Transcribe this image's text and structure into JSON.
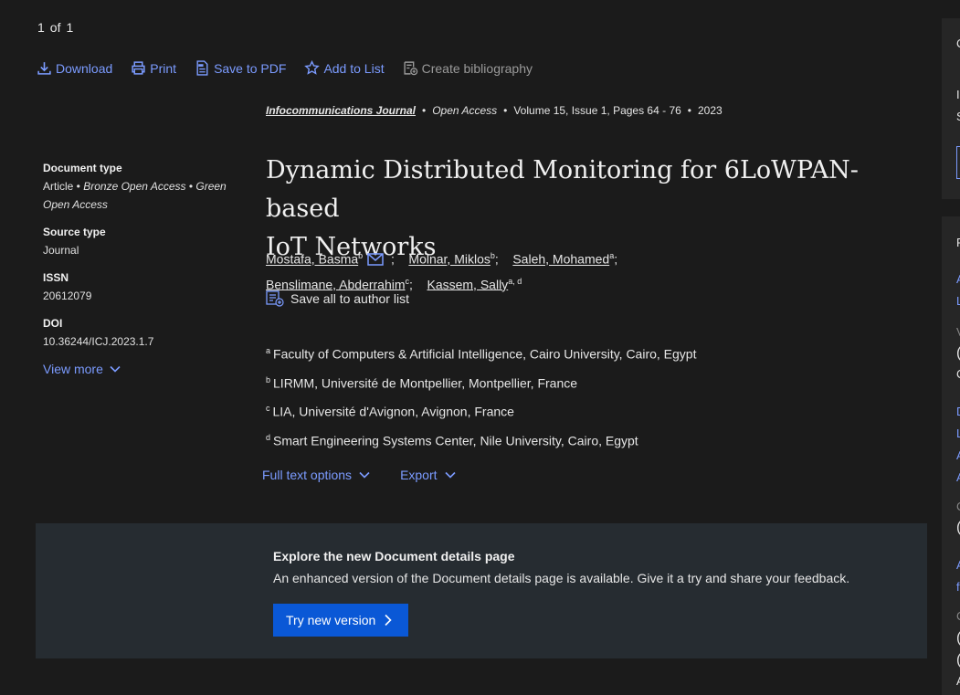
{
  "pager": {
    "current": "1",
    "of": "of",
    "total": "1"
  },
  "toolbar": {
    "download": "Download",
    "print": "Print",
    "save_pdf": "Save to PDF",
    "add_list": "Add to List",
    "bibliography": "Create bibliography"
  },
  "meta": {
    "doctype_label": "Document type",
    "doctype_article": "Article",
    "doctype_bronze": "Bronze Open Access",
    "doctype_green": "Green Open Access",
    "source_label": "Source type",
    "source_value": "Journal",
    "issn_label": "ISSN",
    "issn_value": "20612079",
    "doi_label": "DOI",
    "doi_value": "10.36244/ICJ.2023.1.7",
    "view_more": "View more"
  },
  "source": {
    "journal": "Infocommunications Journal",
    "access": "Open Access",
    "volume": "Volume 15, Issue 1, Pages 64 - 76",
    "year": "2023"
  },
  "title_line1": "Dynamic Distributed Monitoring for 6LoWPAN-based",
  "title_line2": "IoT Networks",
  "authors": [
    {
      "name": "Mostafa, Basma",
      "sup": "b"
    },
    {
      "name": "Molnar, Miklos",
      "sup": "b"
    },
    {
      "name": "Saleh, Mohamed",
      "sup": "a"
    },
    {
      "name": "Benslimane, Abderrahim",
      "sup": "c"
    },
    {
      "name": "Kassem, Sally",
      "sup": "a, d"
    }
  ],
  "save_all": "Save all to author list",
  "affiliations": [
    {
      "sup": "a",
      "text": "Faculty of Computers & Artificial Intelligence, Cairo University, Cairo, Egypt"
    },
    {
      "sup": "b",
      "text": "LIRMM, Université de Montpellier, Montpellier, France"
    },
    {
      "sup": "c",
      "text": "LIA, Université d'Avignon, Avignon, France"
    },
    {
      "sup": "d",
      "text": "Smart Engineering Systems Center, Nile University, Cairo, Egypt"
    }
  ],
  "options": {
    "full_text": "Full text options",
    "export": "Export"
  },
  "banner": {
    "title": "Explore the new Document details page",
    "text": "An enhanced version of the Document details page is available. Give it a try and share your feedback.",
    "button": "Try new version"
  },
  "right_edge": {
    "r1": "C",
    "r2": "I",
    "r3": "S",
    "r4": "F",
    "r5": "A",
    "r6": "L",
    "r7": "V",
    "r8": "(",
    "r9": "C",
    "r10": "D",
    "r11": "L",
    "r12": "A",
    "r13": "A",
    "r14": "C",
    "r15": "(",
    "r16": "A",
    "r17": "f",
    "r18": "C",
    "r19": "(",
    "r20": "(",
    "r21": "A"
  }
}
